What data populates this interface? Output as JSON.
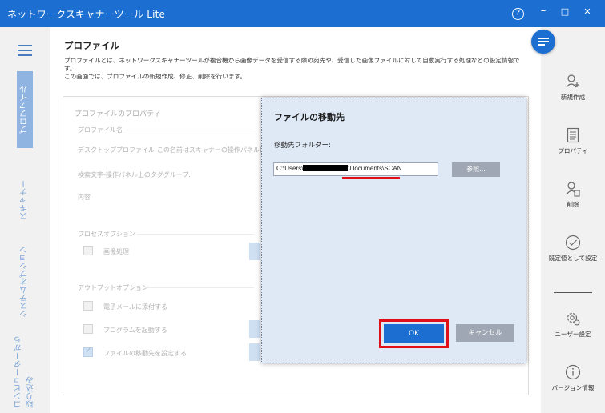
{
  "window": {
    "title": "ネットワークスキャナーツール Lite",
    "help_icon": "?",
    "minimize_icon": "–",
    "maximize_icon": "□",
    "close_icon": "✕"
  },
  "left_nav": {
    "tabs": [
      {
        "label": "プロファイル",
        "active": true
      },
      {
        "label": "スキャナー",
        "active": false
      },
      {
        "label": "システムオプション",
        "active": false
      },
      {
        "label": "コンピューターから取り込み",
        "active": false
      }
    ]
  },
  "main": {
    "title": "プロファイル",
    "description_line1": "プロファイルとは、ネットワークスキャナーツールが複合機から画像データを受信する際の宛先や、受信した画像ファイルに対して自動実行する処理などの設定情報で",
    "description_line2": "す。",
    "description_line3": "この画面では、プロファイルの新規作成、修正、削除を行います。"
  },
  "properties_panel": {
    "header": "プロファイルのプロパティ",
    "profile_name_label": "プロファイル名",
    "profile_name_value": "デスクトッププロファイル-この名前はスキャナーの操作パネルに表示さ",
    "search_label": "検索文字-操作パネル上のタググループ:",
    "content_label": "内容",
    "process_options_label": "プロセスオプション",
    "image_processing_label": "画像処理",
    "output_options_label": "アウトプットオプション",
    "email_attach_label": "電子メールに添付する",
    "launch_program_label": "プログラムを起動する",
    "set_destination_label": "ファイルの移動先を設定する"
  },
  "dialog": {
    "title": "ファイルの移動先",
    "folder_label": "移動先フォルダー:",
    "path_prefix": "C:\\Users\\",
    "path_suffix": "\\Documents\\SCAN",
    "browse_button": "参照...",
    "ok_button": "OK",
    "cancel_button": "キャンセル"
  },
  "right_nav": {
    "items": [
      {
        "label": "新規作成",
        "icon": "add-user-icon"
      },
      {
        "label": "プロパティ",
        "icon": "document-icon"
      },
      {
        "label": "削除",
        "icon": "delete-user-icon"
      },
      {
        "label": "既定値として設定",
        "icon": "check-circle-icon"
      },
      {
        "label": "ユーザー設定",
        "icon": "gear-icon"
      },
      {
        "label": "バージョン情報",
        "icon": "info-icon"
      }
    ]
  },
  "colors": {
    "accent": "#1c6fd1",
    "highlight": "#e0101a",
    "dialog_bg": "#dfe9f6"
  }
}
